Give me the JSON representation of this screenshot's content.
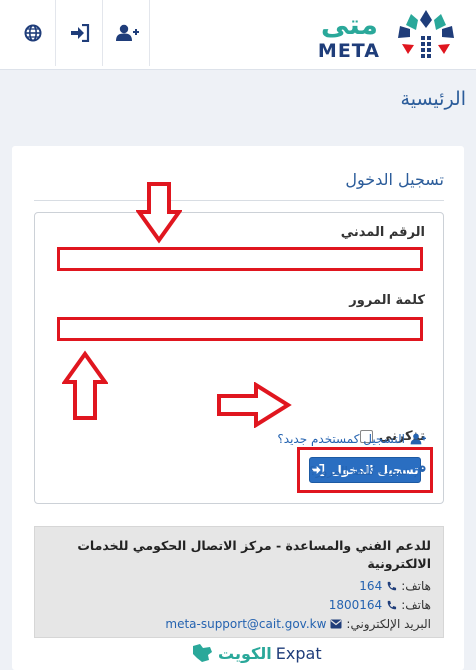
{
  "header": {
    "logo_arabic": "متى",
    "logo_latin": "META",
    "nav": [
      {
        "name": "language",
        "icon": "globe-icon"
      },
      {
        "name": "login",
        "icon": "sign-in-icon"
      },
      {
        "name": "register",
        "icon": "user-plus-icon"
      }
    ]
  },
  "page": {
    "title": "الرئيسية"
  },
  "login": {
    "title": "تسجيل الدخول",
    "civil_id_label": "الرقم المدني",
    "civil_id_value": "",
    "password_label": "كلمة المرور",
    "password_value": "",
    "remember_label": "تذكرني",
    "remember_checked": false,
    "submit_label": "تسجيل الدخول",
    "register_link": "التسجيل كمستخدم جديد؟",
    "forgot_link": "نسيت كلمة المرور؟"
  },
  "support": {
    "title": "للدعم الفني والمساعدة - مركز الاتصال الحكومي للخدمات الالكترونية",
    "phone_label_1": "هاتف:",
    "phone_value_1": "164",
    "phone_label_2": "هاتف:",
    "phone_value_2": "1800164",
    "email_label": "البريد الإلكتروني:",
    "email_value": "meta-support@cait.gov.kw"
  },
  "footer": {
    "brand_arabic": "الكويت",
    "brand_latin": "Expat"
  },
  "colors": {
    "accent": "#2a6ec1",
    "highlight": "#e0161f",
    "brand_teal": "#2aa89a",
    "brand_navy": "#1f3d7a"
  }
}
